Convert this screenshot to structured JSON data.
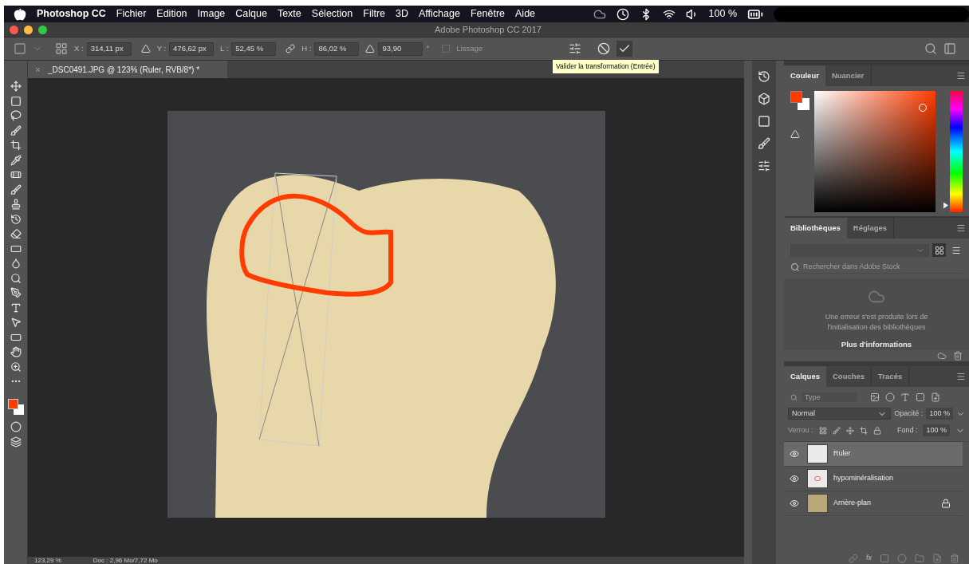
{
  "menu_bar": {
    "app": "Photoshop CC",
    "items": [
      "Fichier",
      "Edition",
      "Image",
      "Calque",
      "Texte",
      "Sélection",
      "Filtre",
      "3D",
      "Affichage",
      "Fenêtre",
      "Aide"
    ],
    "battery": "100 %"
  },
  "window": {
    "title": "Adobe Photoshop CC 2017"
  },
  "options_bar": {
    "fields": [
      {
        "kind": "text",
        "label": "X :",
        "value": "314,11 px"
      },
      {
        "kind": "text",
        "label": "Y :",
        "value": "476,62 px"
      },
      {
        "kind": "text",
        "label": "L :",
        "value": "52,45 %"
      },
      {
        "kind": "text",
        "label": "H :",
        "value": "86,02 %"
      },
      {
        "kind": "angle",
        "value": "93,90",
        "unit": "°"
      }
    ],
    "smoothing": {
      "label": "Lissage",
      "checked": false,
      "disabled": true
    },
    "tooltip": "Valider la transformation (Entrée)"
  },
  "document_tab": {
    "title": "_DSC0491.JPG @ 123% (Ruler, RVB/8*) *"
  },
  "color_panel": {
    "tabs": [
      {
        "label": "Couleur",
        "selected": true
      },
      {
        "label": "Nuancier",
        "selected": false
      }
    ],
    "hue": {
      "level": 0.03
    }
  },
  "libraries_panel": {
    "tabs": [
      {
        "label": "Bibliothèques",
        "selected": true
      },
      {
        "label": "Réglages",
        "selected": false
      }
    ],
    "view_modes": [
      {
        "kind": "grid",
        "selected": true
      },
      {
        "kind": "list",
        "selected": false
      }
    ],
    "search": {
      "placeholder": "Rechercher dans Adobe Stock"
    },
    "error": "Une erreur s'est produite lors de l'initialisation des bibliothèques",
    "link": "Plus d'informations"
  },
  "layers_panel": {
    "tabs": [
      {
        "label": "Calques",
        "selected": true
      },
      {
        "label": "Couches",
        "selected": false
      },
      {
        "label": "Tracés",
        "selected": false
      }
    ],
    "filter": {
      "placeholder": "Type"
    },
    "fx_label": "fx",
    "blend_mode": "Normal",
    "opacity_label": "Opacité :",
    "opacity": "100 %",
    "lock_label": "Verrou :",
    "fill_label": "Fond :",
    "fill": "100 %",
    "layers": [
      {
        "name": "Ruler",
        "kind": "empty",
        "selected": true,
        "visible": true,
        "locked": false
      },
      {
        "name": "hypominéralisation",
        "kind": "sketch",
        "selected": false,
        "visible": true,
        "locked": false
      },
      {
        "name": "Arrière-plan",
        "kind": "photo",
        "selected": false,
        "visible": true,
        "locked": true
      }
    ]
  },
  "status_bar": {
    "zoom": "123,29 %",
    "doc": "Doc : 2,96 Mo/7,72 Mo"
  }
}
